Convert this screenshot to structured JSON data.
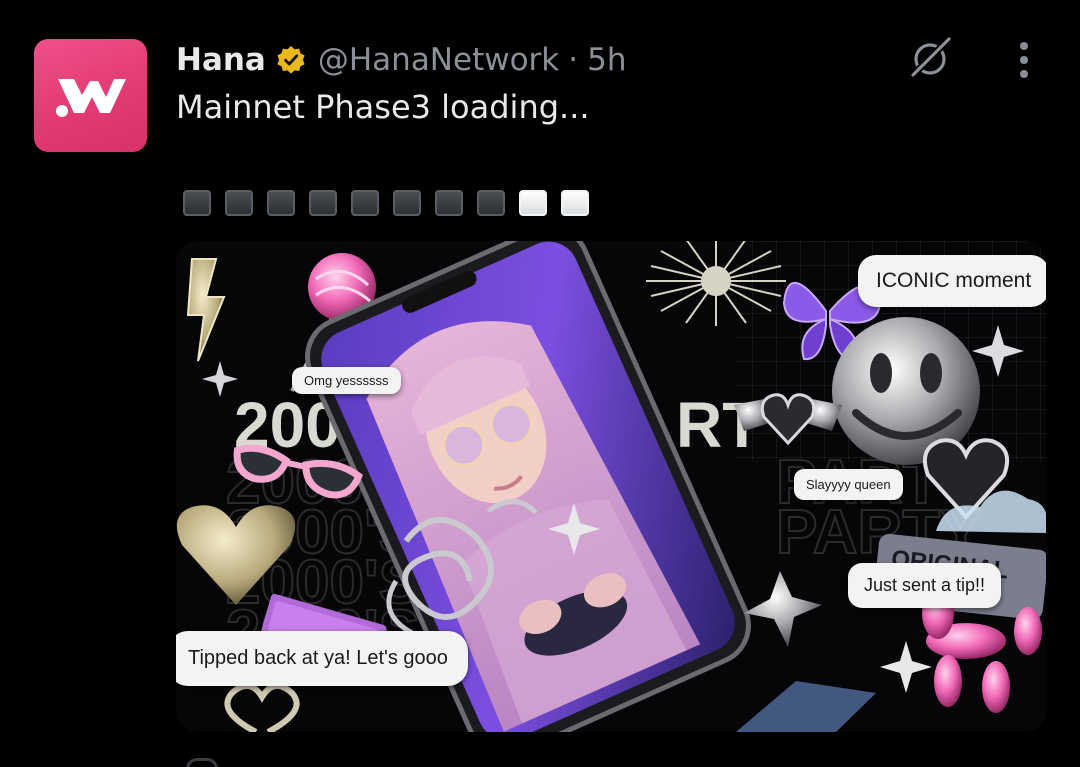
{
  "tweet": {
    "author_name": "Hana",
    "handle": "@HanaNetwork",
    "separator": "·",
    "time": "5h",
    "text": "Mainnet Phase3 loading...",
    "progress": {
      "filled": 8,
      "total": 10
    },
    "avatar_icon": "hana-w-logo-icon",
    "verified_icon": "verified-badge-icon",
    "menu_icons": [
      "grok-icon",
      "more-vertical-icon"
    ]
  },
  "media": {
    "bubbles": {
      "omg": "Omg yessssss",
      "iconic": "ICONIC moment",
      "slay": "Slayyyy queen",
      "tip": "Just sent a tip!!",
      "tipped_back": "Tipped back at ya! Let's gooo"
    },
    "graphic_text": {
      "year": "2000",
      "year_partial": "RT",
      "original": "ORIGINAL"
    }
  },
  "colors": {
    "background": "#000000",
    "text_primary": "#e7e9ea",
    "text_secondary": "#8b9096",
    "avatar_pink": "#e23a74",
    "verified_gold": "#e8b81c",
    "accent_purple": "#7a4fd6"
  }
}
